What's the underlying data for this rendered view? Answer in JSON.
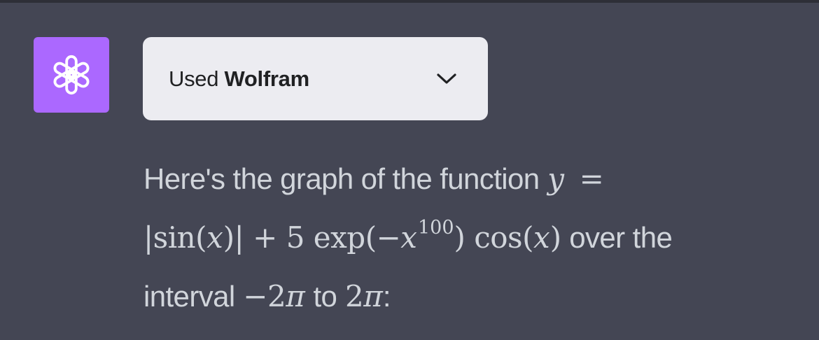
{
  "avatar": {
    "icon": "openai-logo-icon",
    "color": "#ab68ff"
  },
  "plugin": {
    "prefix": "Used",
    "name": "Wolfram",
    "chevron_icon": "chevron-down-icon"
  },
  "message": {
    "line1": {
      "text": "Here's the graph of the function",
      "math_var": "y",
      "math_eq": "="
    },
    "line2": {
      "math_a": "|sin(",
      "math_x1": "x",
      "math_b": ")| + 5 exp(−",
      "math_x2": "x",
      "math_exp": "100",
      "math_c": ") cos(",
      "math_x3": "x",
      "math_d": ")",
      "text": "over the"
    },
    "line3": {
      "text_a": "interval",
      "math_a": "−2",
      "pi_a": "π",
      "text_b": "to",
      "math_b": "2",
      "pi_b": "π",
      "text_c": ":"
    }
  },
  "colors": {
    "background": "#444654",
    "chip_background": "#ececf1",
    "text": "#d1d5db"
  }
}
